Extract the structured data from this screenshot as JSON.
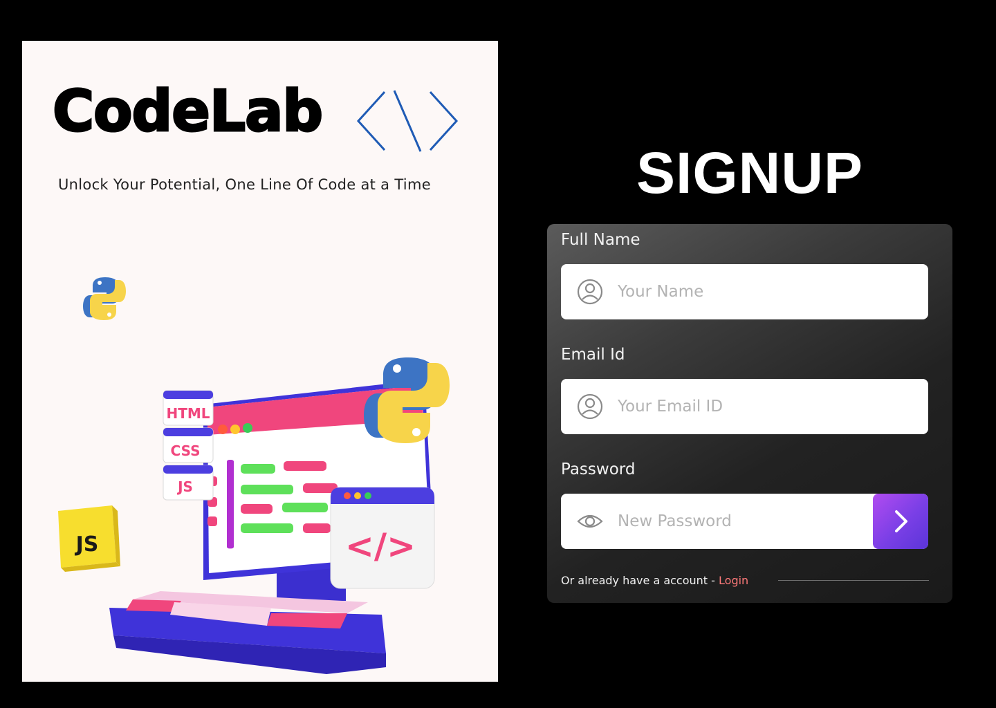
{
  "brand": {
    "title": "CodeLab",
    "tagline": "Unlock Your Potential, One Line Of Code at a Time"
  },
  "illustration": {
    "badges": [
      "HTML",
      "CSS",
      "JS"
    ],
    "js_cube": "JS",
    "code_window": "</>"
  },
  "signup": {
    "title": "SIGNUP",
    "fields": [
      {
        "label": "Full Name",
        "placeholder": "Your Name",
        "icon": "user-icon"
      },
      {
        "label": "Email Id",
        "placeholder": "Your Email ID",
        "icon": "user-icon"
      },
      {
        "label": "Password",
        "placeholder": "New Password",
        "icon": "eye-icon"
      }
    ],
    "footer_text": "Or already have a account - ",
    "login_label": "Login"
  },
  "colors": {
    "page_bg": "#000000",
    "poster_bg": "#fdf8f7",
    "accent_purple": "#7a3fe6",
    "login_link": "#ff7a7a",
    "code_mark_blue": "#1f5bb5"
  }
}
